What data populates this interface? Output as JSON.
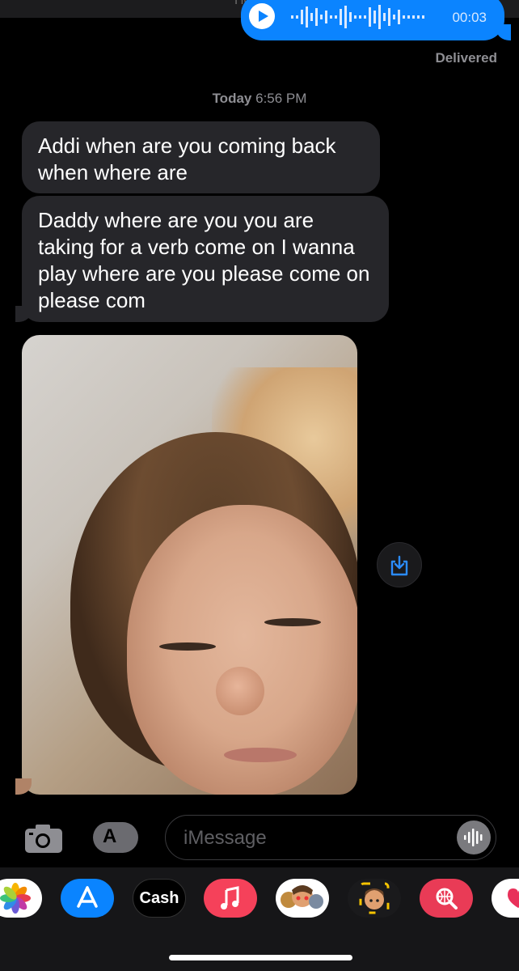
{
  "top": {
    "faded_header": "Home"
  },
  "outgoing_audio": {
    "duration": "00:03"
  },
  "status": {
    "delivered": "Delivered"
  },
  "timestamp": {
    "day": "Today",
    "time": "6:56 PM"
  },
  "messages": [
    {
      "text": "Addi when are you coming back when where are"
    },
    {
      "text": "Daddy where are you you are taking for a verb come on I wanna play where are you please come on please com"
    }
  ],
  "composer": {
    "placeholder": "iMessage"
  },
  "app_drawer": {
    "apps": [
      {
        "name": "photos-app-icon"
      },
      {
        "name": "app-store-icon"
      },
      {
        "name": "apple-cash-icon",
        "label": "Cash"
      },
      {
        "name": "music-app-icon"
      },
      {
        "name": "memoji-stickers-icon"
      },
      {
        "name": "memoji-icon"
      },
      {
        "name": "web-search-icon"
      },
      {
        "name": "digital-touch-icon"
      }
    ]
  },
  "colors": {
    "outgoing": "#0b84ff",
    "incoming": "#26262a",
    "background": "#000000"
  }
}
